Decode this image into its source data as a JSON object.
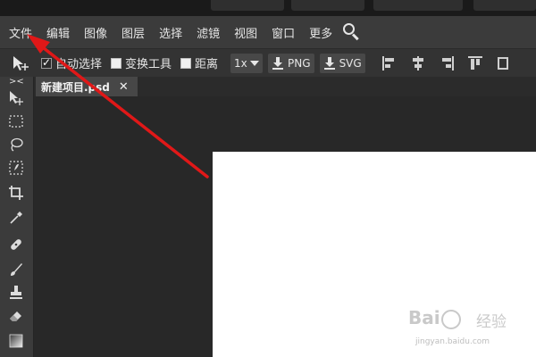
{
  "menubar": {
    "items": [
      "文件",
      "编辑",
      "图像",
      "图层",
      "选择",
      "滤镜",
      "视图",
      "窗口",
      "更多"
    ]
  },
  "options": {
    "auto_select_label": "自动选择",
    "auto_select_checked": true,
    "transform_label": "变换工具",
    "transform_checked": false,
    "distance_label": "距离",
    "distance_checked": false,
    "zoom_value": "1x",
    "png_label": "PNG",
    "svg_label": "SVG"
  },
  "toolbar": {
    "collapse_label": "><",
    "tools": [
      "move-tool-icon",
      "marquee-tool-icon",
      "lasso-tool-icon",
      "quick-select-icon",
      "crop-tool-icon",
      "eyedropper-tool-icon",
      "healing-brush-icon",
      "brush-tool-icon",
      "stamp-tool-icon",
      "eraser-tool-icon",
      "gradient-tool-icon"
    ]
  },
  "tabs": [
    {
      "label": "新建项目.psd",
      "close": "✕"
    }
  ],
  "watermark": {
    "brand": "Bai 经验",
    "brand_left": "Bai",
    "brand_right": "经验",
    "url": "jingyan.baidu.com"
  },
  "colors": {
    "annotation_arrow": "#e01818",
    "canvas": "#ffffff",
    "menubar_bg": "#3b3b3b"
  }
}
